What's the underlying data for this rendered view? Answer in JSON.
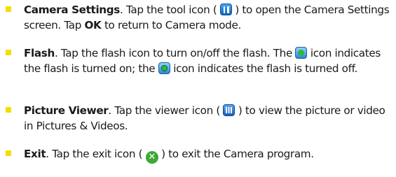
{
  "items": [
    {
      "title": "Camera Settings",
      "p1": ". Tap the tool icon ( ",
      "icon": "tool-icon",
      "p2": " ) to open the Camera Settings screen. Tap ",
      "ok": "OK",
      "p3": " to return to Camera mode."
    },
    {
      "title": "Flash",
      "p1": ". Tap the flash icon to turn on/off the flash. The ",
      "icon_on": "flash-on-icon",
      "p2": " icon indicates the flash is turned on; the ",
      "icon_off": "flash-off-icon",
      "p3": " icon indicates the flash is turned off."
    },
    {
      "title": "Picture Viewer",
      "p1": ". Tap the viewer icon ( ",
      "icon": "viewer-icon",
      "p2": " ) to view the picture or video in Pictures & Videos."
    },
    {
      "title": "Exit",
      "p1": ". Tap the exit icon ( ",
      "icon": "exit-icon",
      "p2": " ) to exit the Camera program."
    }
  ],
  "bullet_color": "#f2df00",
  "icon_blue": "#1266bd",
  "exit_green": "#3ea83a"
}
